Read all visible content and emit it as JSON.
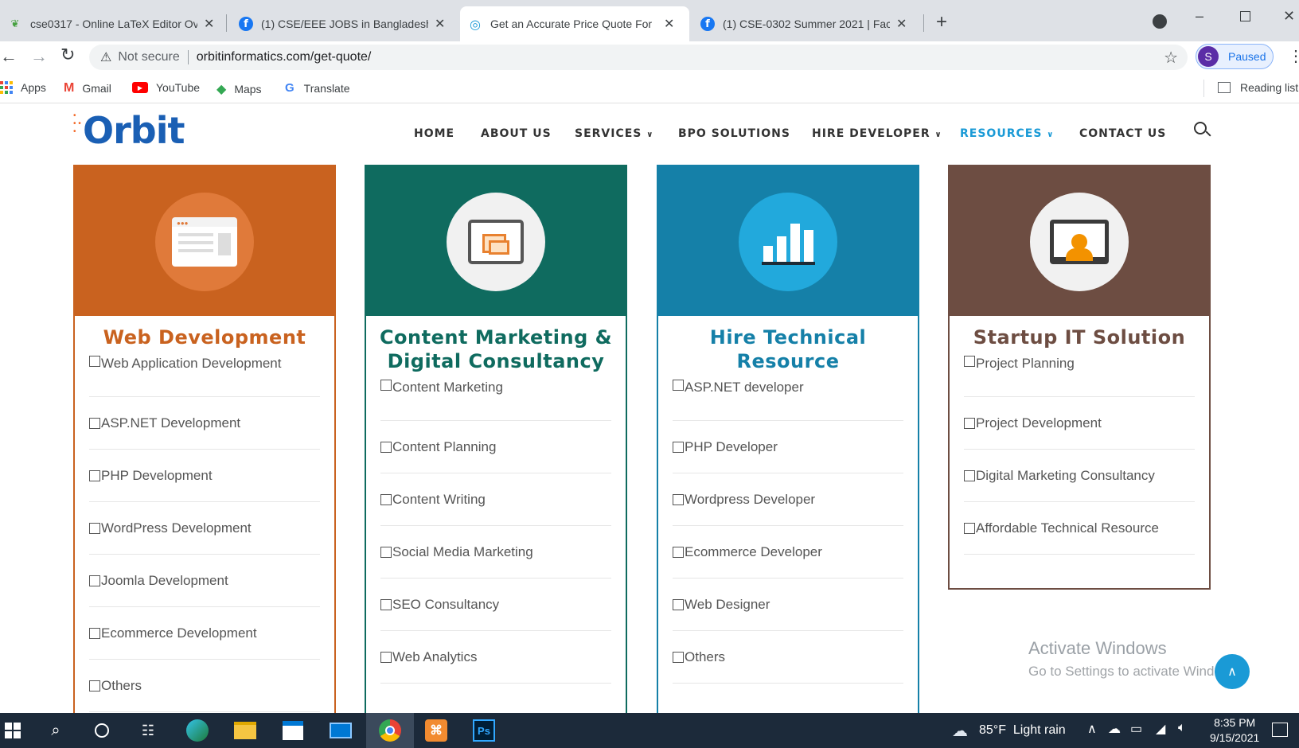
{
  "browser": {
    "tabs": [
      {
        "title": "cse0317 - Online LaTeX Editor Ov",
        "icon": "overleaf-icon",
        "active": false
      },
      {
        "title": "(1) CSE/EEE JOBS in Bangladesh |",
        "icon": "facebook-icon",
        "active": false
      },
      {
        "title": "Get an Accurate Price Quote For",
        "icon": "orbit-icon",
        "active": true
      },
      {
        "title": "(1) CSE-0302 Summer 2021 | Face",
        "icon": "facebook-icon",
        "active": false
      }
    ],
    "new_tab": "+",
    "security": "Not secure",
    "url": "orbitinformatics.com/get-quote/",
    "profile_initial": "S",
    "profile_status": "Paused",
    "bookmarks": [
      "Apps",
      "Gmail",
      "YouTube",
      "Maps",
      "Translate"
    ],
    "reading_list": "Reading list"
  },
  "site": {
    "logo": "Orbit",
    "nav": [
      "HOME",
      "ABOUT US",
      "SERVICES",
      "BPO SOLUTIONS",
      "HIRE DEVELOPER",
      "RESOURCES",
      "CONTACT US"
    ],
    "nav_active": "RESOURCES",
    "accent": "#1a9ad6"
  },
  "cards": [
    {
      "title": "Web Development",
      "color": "#c9621f",
      "items": [
        "Web Application Development",
        "ASP.NET Development",
        "PHP Development",
        "WordPress Development",
        "Joomla Development",
        "Ecommerce Development",
        "Others"
      ]
    },
    {
      "title": "Content Marketing & Digital Consultancy",
      "color": "#0f6b5f",
      "items": [
        "Content Marketing",
        "Content Planning",
        "Content Writing",
        "Social Media Marketing",
        "SEO Consultancy",
        "Web Analytics"
      ]
    },
    {
      "title": "Hire Technical Resource",
      "color": "#1580a8",
      "items": [
        "ASP.NET developer",
        "PHP Developer",
        "Wordpress Developer",
        "Ecommerce Developer",
        "Web Designer",
        "Others"
      ]
    },
    {
      "title": "Startup IT Solution",
      "color": "#6d4d42",
      "items": [
        "Project Planning",
        "Project Development",
        "Digital Marketing Consultancy",
        "Affordable Technical Resource"
      ]
    }
  ],
  "watermark": {
    "line1": "Activate Windows",
    "line2": "Go to Settings to activate Windows."
  },
  "taskbar": {
    "weather": "85°F  Light rain",
    "time": "8:35 PM",
    "date": "9/15/2021"
  }
}
